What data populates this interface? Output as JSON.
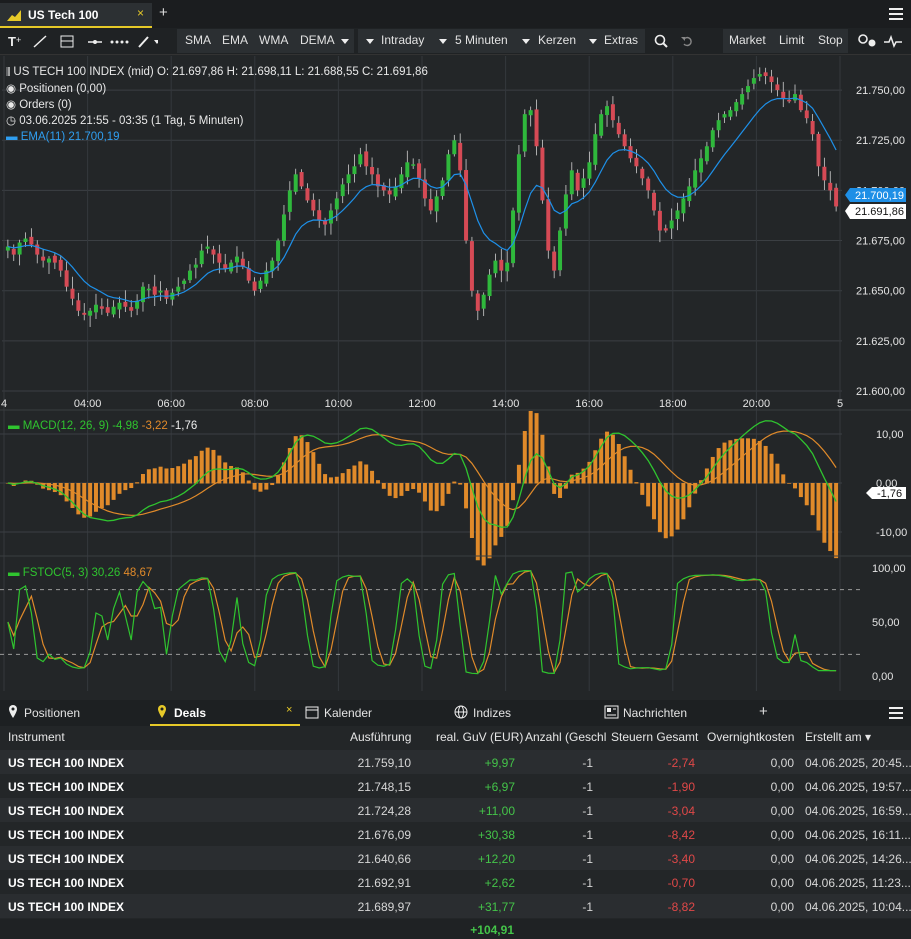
{
  "tab": {
    "title": "US Tech 100",
    "close": "×",
    "add": "+"
  },
  "toolbar": {
    "indicators": [
      "SMA",
      "EMA",
      "WMA",
      "DEMA"
    ],
    "interval": "Intraday",
    "period": "5 Minuten",
    "chart_type": "Kerzen",
    "extras": "Extras",
    "orders": [
      "Market",
      "Limit",
      "Stop"
    ]
  },
  "info": {
    "line1": "US TECH 100 INDEX (mid)  O: 21.697,86  H: 21.698,11  L: 21.688,55  C: 21.691,86",
    "positions": "Positionen (0,00)",
    "orders": "Orders (0)",
    "time": "03.06.2025 21:55 - 03:35   (1 Tag, 5 Minuten)",
    "ema": "EMA(11)  21.700,19"
  },
  "chart_data": {
    "type": "candlestick",
    "price_ticks": [
      "21.750,00",
      "21.725,00",
      "21.700,00",
      "21.675,00",
      "21.650,00",
      "21.625,00",
      "21.600,00"
    ],
    "ylim": [
      21600,
      21765
    ],
    "time_ticks": [
      "4",
      "04:00",
      "06:00",
      "08:00",
      "10:00",
      "12:00",
      "14:00",
      "16:00",
      "18:00",
      "20:00",
      "5"
    ],
    "last_ema": "21.700,19",
    "last_price": "21.691,86",
    "ema_color": "#1e90e8",
    "up_color": "#2fb83c",
    "down_color": "#d64a55",
    "series_close": [
      21672,
      21668,
      21674,
      21676,
      21673,
      21668,
      21665,
      21666,
      21664,
      21660,
      21652,
      21646,
      21640,
      21638,
      21640,
      21643,
      21641,
      21639,
      21642,
      21644,
      21642,
      21640,
      21645,
      21652,
      21651,
      21648,
      21650,
      21646,
      21649,
      21652,
      21655,
      21660,
      21663,
      21670,
      21672,
      21668,
      21664,
      21661,
      21664,
      21667,
      21662,
      21655,
      21650,
      21655,
      21660,
      21665,
      21675,
      21688,
      21700,
      21708,
      21702,
      21695,
      21690,
      21685,
      21683,
      21690,
      21696,
      21703,
      21708,
      21712,
      21718,
      21712,
      21708,
      21702,
      21700,
      21698,
      21702,
      21708,
      21714,
      21713,
      21706,
      21696,
      21690,
      21697,
      21705,
      21718,
      21725,
      21710,
      21675,
      21650,
      21640,
      21648,
      21658,
      21665,
      21660,
      21664,
      21690,
      21718,
      21738,
      21740,
      21722,
      21695,
      21670,
      21660,
      21680,
      21698,
      21710,
      21700,
      21706,
      21714,
      21728,
      21738,
      21742,
      21735,
      21728,
      21722,
      21716,
      21712,
      21706,
      21700,
      21690,
      21680,
      21680,
      21685,
      21690,
      21696,
      21702,
      21710,
      21716,
      21722,
      21730,
      21735,
      21738,
      21740,
      21744,
      21748,
      21752,
      21756,
      21758,
      21757,
      21754,
      21750,
      21746,
      21745,
      21748,
      21740,
      21736,
      21728,
      21712,
      21705,
      21700,
      21692
    ]
  },
  "macd": {
    "label": "MACD(12, 26, 9)",
    "v1": "-4,98",
    "v2": "-3,22",
    "v3": "-1,76",
    "ticks": [
      "10,00",
      "0,00",
      "-10,00"
    ],
    "current": "-1,76",
    "green": "#2fc42f",
    "orange": "#e08a2a"
  },
  "fstoc": {
    "label": "FSTOC(5, 3)",
    "v1": "30,26",
    "v2": "48,67",
    "ticks": [
      "100,00",
      "50,00",
      "0,00"
    ]
  },
  "bottom_tabs": [
    "Positionen",
    "Deals",
    "Kalender",
    "Indizes",
    "Nachrichten"
  ],
  "columns": [
    "Instrument",
    "Ausführung",
    "real. GuV (EUR)",
    "Anzahl (Geschl",
    "Steuern Gesamt",
    "Overnightkosten",
    "Erstellt am ▾"
  ],
  "rows": [
    [
      "US TECH 100 INDEX",
      "21.759,10",
      "+9,97",
      "-1",
      "-2,74",
      "0,00",
      "04.06.2025, 20:45..."
    ],
    [
      "US TECH 100 INDEX",
      "21.748,15",
      "+6,97",
      "-1",
      "-1,90",
      "0,00",
      "04.06.2025, 19:57..."
    ],
    [
      "US TECH 100 INDEX",
      "21.724,28",
      "+11,00",
      "-1",
      "-3,04",
      "0,00",
      "04.06.2025, 16:59..."
    ],
    [
      "US TECH 100 INDEX",
      "21.676,09",
      "+30,38",
      "-1",
      "-8,42",
      "0,00",
      "04.06.2025, 16:11..."
    ],
    [
      "US TECH 100 INDEX",
      "21.640,66",
      "+12,20",
      "-1",
      "-3,40",
      "0,00",
      "04.06.2025, 14:26..."
    ],
    [
      "US TECH 100 INDEX",
      "21.692,91",
      "+2,62",
      "-1",
      "-0,70",
      "0,00",
      "04.06.2025, 11:23..."
    ],
    [
      "US TECH 100 INDEX",
      "21.689,97",
      "+31,77",
      "-1",
      "-8,82",
      "0,00",
      "04.06.2025, 10:04..."
    ]
  ],
  "total": "+104,91"
}
